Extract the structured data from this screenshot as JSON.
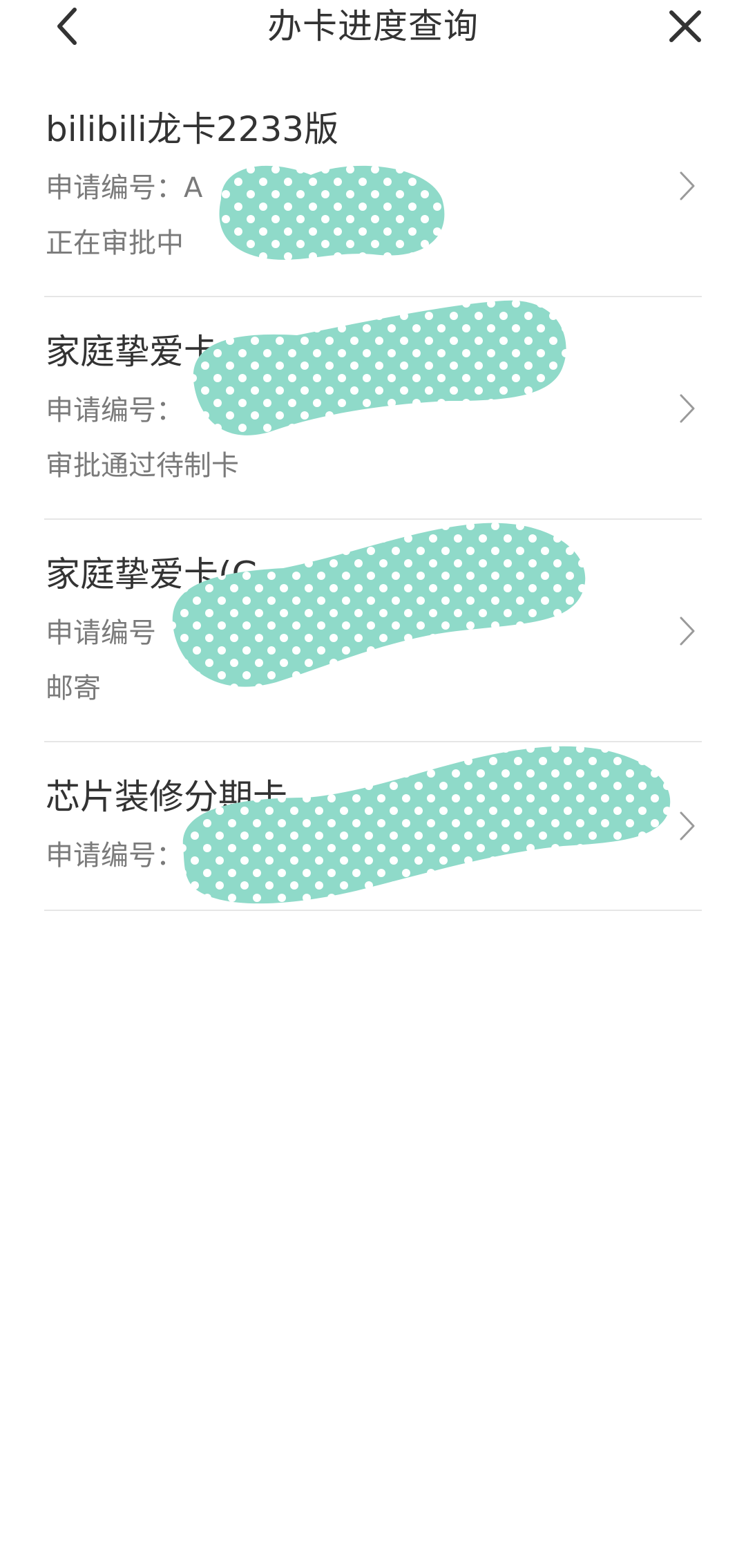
{
  "header": {
    "title": "办卡进度查询",
    "back_icon": "chevron-left-icon",
    "close_icon": "close-icon"
  },
  "applications": [
    {
      "card_name": "bilibili龙卡2233版",
      "app_no_label": "申请编号：A",
      "status": "正在审批中"
    },
    {
      "card_name": "家庭挚爱卡",
      "app_no_label": "申请编号：",
      "status": "审批通过待制卡"
    },
    {
      "card_name": "家庭挚爱卡(G",
      "app_no_label": "申请编号",
      "status": "邮寄"
    },
    {
      "card_name": "芯片装修分期卡",
      "app_no_label": "申请编号："
    }
  ],
  "colors": {
    "redaction_fill": "#8fdac9",
    "redaction_dots": "#ffffff",
    "text_primary": "#333333",
    "text_secondary": "#7a7a7a",
    "divider": "#e6e6e6"
  }
}
